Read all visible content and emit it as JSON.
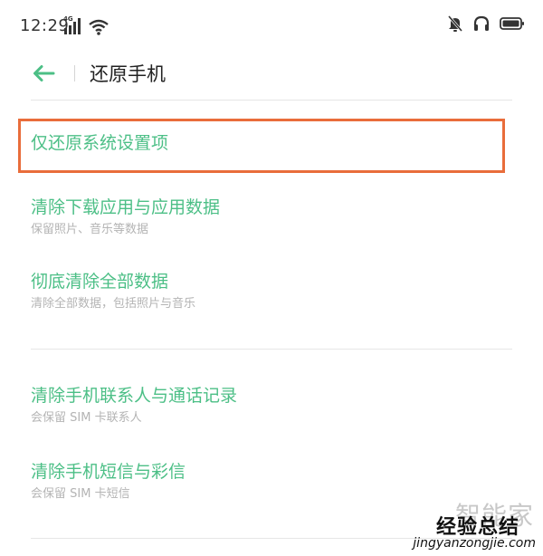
{
  "status_bar": {
    "time": "12:29",
    "network_badge": "4G",
    "icons": [
      "4g-signal-icon",
      "wifi-icon",
      "mute-icon",
      "headset-icon",
      "battery-icon"
    ]
  },
  "header": {
    "back_icon": "arrow-left-icon",
    "title": "还原手机"
  },
  "options": [
    {
      "title": "仅还原系统设置项",
      "subtitle": ""
    },
    {
      "title": "清除下载应用与应用数据",
      "subtitle": "保留照片、音乐等数据"
    },
    {
      "title": "彻底清除全部数据",
      "subtitle": "清除全部数据，包括照片与音乐"
    },
    {
      "title": "清除手机联系人与通话记录",
      "subtitle": "会保留 SIM 卡联系人"
    },
    {
      "title": "清除手机短信与彩信",
      "subtitle": "会保留 SIM 卡短信"
    }
  ],
  "colors": {
    "accent_green": "#4cbf86",
    "highlight_orange": "#e96d3b",
    "subtitle_gray": "#b4b4b4"
  },
  "watermark": {
    "brand": "智能家",
    "main": "经验总结",
    "url": "jingyanzongjie.com"
  }
}
